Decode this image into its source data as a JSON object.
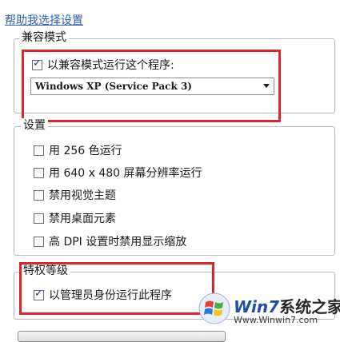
{
  "help_link": "帮助我选择设置",
  "compatibility_mode": {
    "legend": "兼容模式",
    "run_checkbox_label": "以兼容模式运行这个程序:",
    "run_checked": true,
    "selected_os": "Windows XP (Service Pack 3)"
  },
  "settings": {
    "legend": "设置",
    "options": [
      {
        "label": "用 256 色运行",
        "checked": false
      },
      {
        "label": "用 640 x 480 屏幕分辨率运行",
        "checked": false
      },
      {
        "label": "禁用视觉主题",
        "checked": false
      },
      {
        "label": "禁用桌面元素",
        "checked": false
      },
      {
        "label": "高 DPI 设置时禁用显示缩放",
        "checked": false
      }
    ]
  },
  "privilege_level": {
    "legend": "特权等级",
    "admin_label": "以管理员身份运行此程序",
    "admin_checked": true
  },
  "watermark": {
    "brand": "Win7",
    "title_suffix": "系统之家",
    "url": "Www.Winwin7.com"
  },
  "colors": {
    "highlight": "#e0242e",
    "link": "#2d5fb3"
  }
}
